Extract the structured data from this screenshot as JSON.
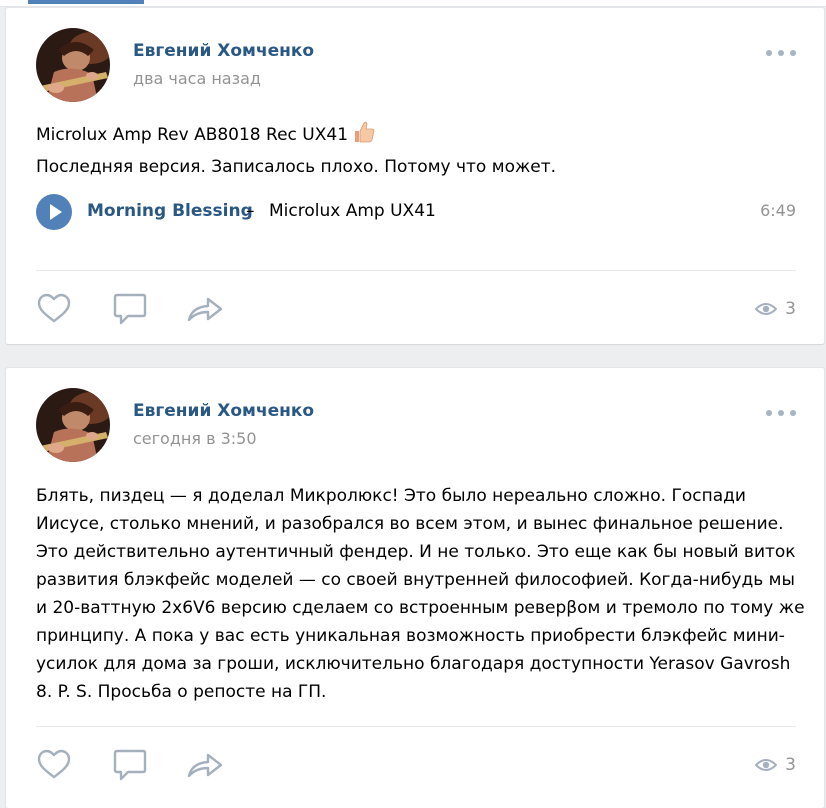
{
  "posts": [
    {
      "author": "Евгений Хомченко",
      "time": "два часа назад",
      "text_line1": "Microlux Amp Rev AB8018 Rec UX41",
      "text_line2": "Последняя версия. Записалось плохо. Потому что может.",
      "audio": {
        "artist": "Morning Blessing",
        "separator": "–",
        "title": "Microlux Amp UX41",
        "duration": "6:49"
      },
      "views": "3"
    },
    {
      "author": "Евгений Хомченко",
      "time": "сегодня в 3:50",
      "text": "Блять, пиздец — я доделал Микролюкс! Это было нереально сложно. Госпади Иисусе, столько мнений, и разобрался во всем этом, и вынес финальное решение. Это действительно аутентичный фендер. И не только. Это еще как бы новый виток развития блэкфейс моделей — со своей внутренней философией. Когда-нибудь мы и 20-ваттную 2х6V6 версию сделаем со встроенным реверβом и тремоло по тому же принципу. А пока у вас есть уникальная возможность приобрести блэкфейс мини-усилок для дома за гроши, исключительно благодаря доступности Yerasov Gavrosh 8. P. S. Просьба о репосте на ГП.",
      "views": "3"
    }
  ],
  "icons": {
    "like": "heart-icon",
    "comment": "comment-icon",
    "share": "share-icon",
    "views": "eye-icon",
    "more": "more-dots-icon",
    "play": "play-icon",
    "emoji": "thumbs-up-icon"
  },
  "colors": {
    "accent": "#5181b8",
    "link": "#2a5885",
    "muted": "#939393",
    "background": "#edeef0"
  }
}
